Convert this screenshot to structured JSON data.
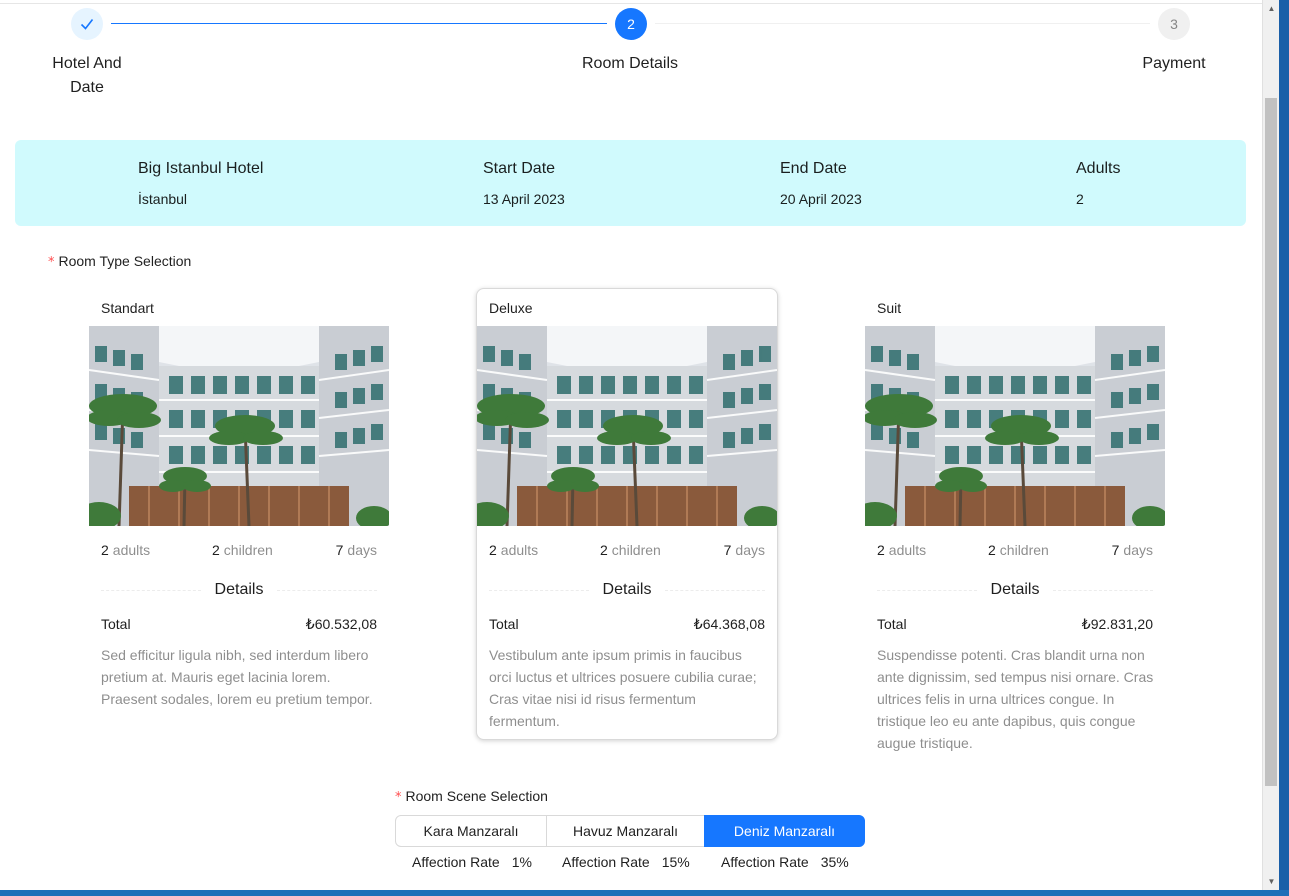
{
  "steps": [
    {
      "index": "1",
      "title": "Hotel And Date",
      "status": "finished",
      "icon": "check-icon"
    },
    {
      "index": "2",
      "title": "Room Details",
      "status": "current"
    },
    {
      "index": "3",
      "title": "Payment",
      "status": "waiting"
    }
  ],
  "hotel_info": {
    "hotel_name": "Big Istanbul Hotel",
    "city": "İstanbul",
    "start_date_label": "Start Date",
    "start_date": "13 April 2023",
    "end_date_label": "End Date",
    "end_date": "20 April 2023",
    "adults_label": "Adults",
    "adults": "2"
  },
  "room_type": {
    "label": "Room Type Selection",
    "required_mark": "*",
    "selected": "Deluxe",
    "cards": [
      {
        "title": "Standart",
        "adults_count": "2",
        "adults_unit": "adults",
        "children_count": "2",
        "children_unit": "children",
        "days_count": "7",
        "days_unit": "days",
        "details_label": "Details",
        "total_label": "Total",
        "total_value": "₺60.532,08",
        "description": "Sed efficitur ligula nibh, sed interdum libero pretium at. Mauris eget lacinia lorem. Praesent sodales, lorem eu pretium tempor."
      },
      {
        "title": "Deluxe",
        "adults_count": "2",
        "adults_unit": "adults",
        "children_count": "2",
        "children_unit": "children",
        "days_count": "7",
        "days_unit": "days",
        "details_label": "Details",
        "total_label": "Total",
        "total_value": "₺64.368,08",
        "description": "Vestibulum ante ipsum primis in faucibus orci luctus et ultrices posuere cubilia curae; Cras vitae nisi id risus fermentum fermentum."
      },
      {
        "title": "Suit",
        "adults_count": "2",
        "adults_unit": "adults",
        "children_count": "2",
        "children_unit": "children",
        "days_count": "7",
        "days_unit": "days",
        "details_label": "Details",
        "total_label": "Total",
        "total_value": "₺92.831,20",
        "description": "Suspendisse potenti. Cras blandit urna non ante dignissim, sed tempus nisi ornare. Cras ultrices felis in urna ultrices congue. In tristique leo eu ante dapibus, quis congue augue tristique."
      }
    ]
  },
  "room_scene": {
    "label": "Room Scene Selection",
    "required_mark": "*",
    "selected": "Deniz Manzaralı",
    "options": [
      {
        "label": "Kara Manzaralı",
        "rate_label": "Affection Rate",
        "rate": "1%"
      },
      {
        "label": "Havuz Manzaralı",
        "rate_label": "Affection Rate",
        "rate": "15%"
      },
      {
        "label": "Deniz Manzaralı",
        "rate_label": "Affection Rate",
        "rate": "35%"
      }
    ]
  },
  "colors": {
    "primary": "#1677ff",
    "info_background": "#d0fafd",
    "required": "#ff4d4f"
  }
}
